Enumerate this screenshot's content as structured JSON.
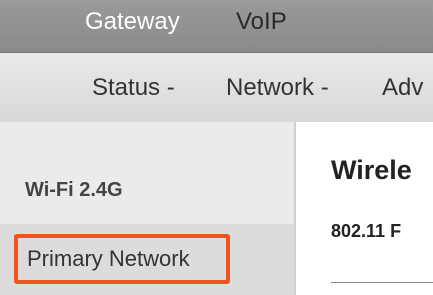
{
  "top_tabs": [
    "Gateway",
    "VoIP"
  ],
  "sub_menu": [
    "Status -",
    "Network -",
    "Adv"
  ],
  "sidebar": {
    "section_title": "Wi-Fi 2.4G",
    "items": [
      {
        "label": "Primary Network",
        "selected": true
      }
    ]
  },
  "content": {
    "title": "Wirele",
    "subtitle": "802.11 F"
  },
  "colors": {
    "highlight_border": "#f0531d",
    "topbar": "#8f8f8f",
    "sidebar_bg": "#ebebeb"
  }
}
